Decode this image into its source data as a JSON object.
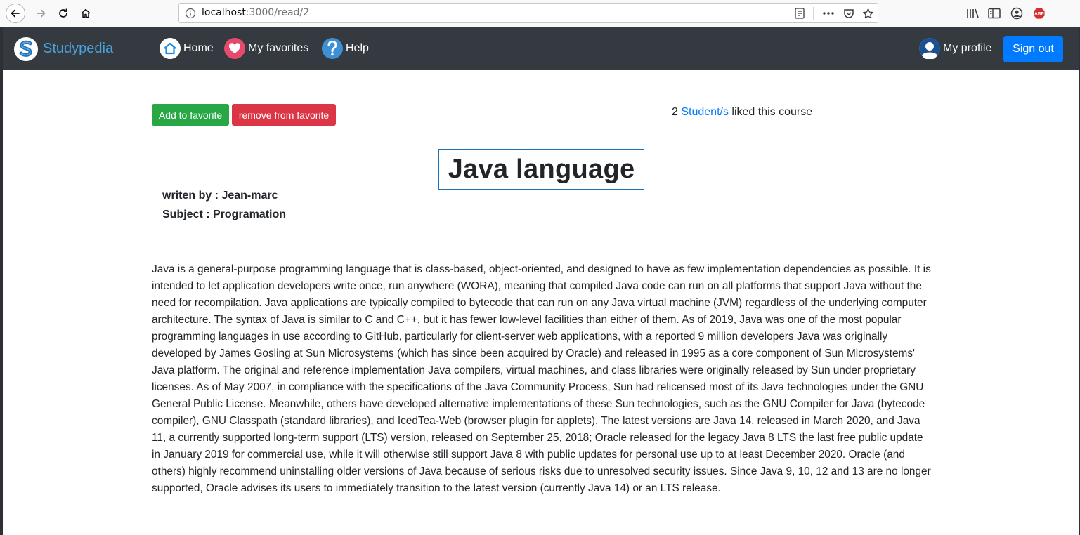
{
  "browser": {
    "url_host": "localhost",
    "url_path": ":3000/read/2"
  },
  "navbar": {
    "brand": "Studypedia",
    "home": "Home",
    "favorites": "My favorites",
    "help": "Help",
    "profile": "My profile",
    "signout": "Sign out"
  },
  "actions": {
    "add": "Add to favorite",
    "remove": "remove from favorite"
  },
  "likes": {
    "count": "2",
    "link": "Student/s",
    "suffix": "liked this course"
  },
  "course": {
    "title": "Java language",
    "author": "writen by : Jean-marc",
    "subject": "Subject : Programation",
    "body": "Java is a general-purpose programming language that is class-based, object-oriented, and designed to have as few implementation dependencies as possible. It is intended to let application developers write once, run anywhere (WORA), meaning that compiled Java code can run on all platforms that support Java without the need for recompilation. Java applications are typically compiled to bytecode that can run on any Java virtual machine (JVM) regardless of the underlying computer architecture. The syntax of Java is similar to C and C++, but it has fewer low-level facilities than either of them. As of 2019, Java was one of the most popular programming languages in use according to GitHub, particularly for client-server web applications, with a reported 9 million developers Java was originally developed by James Gosling at Sun Microsystems (which has since been acquired by Oracle) and released in 1995 as a core component of Sun Microsystems' Java platform. The original and reference implementation Java compilers, virtual machines, and class libraries were originally released by Sun under proprietary licenses. As of May 2007, in compliance with the specifications of the Java Community Process, Sun had relicensed most of its Java technologies under the GNU General Public License. Meanwhile, others have developed alternative implementations of these Sun technologies, such as the GNU Compiler for Java (bytecode compiler), GNU Classpath (standard libraries), and IcedTea-Web (browser plugin for applets). The latest versions are Java 14, released in March 2020, and Java 11, a currently supported long-term support (LTS) version, released on September 25, 2018; Oracle released for the legacy Java 8 LTS the last free public update in January 2019 for commercial use, while it will otherwise still support Java 8 with public updates for personal use up to at least December 2020. Oracle (and others) highly recommend uninstalling older versions of Java because of serious risks due to unresolved security issues. Since Java 9, 10, 12 and 13 are no longer supported, Oracle advises its users to immediately transition to the latest version (currently Java 14) or an LTS release."
  },
  "colors": {
    "navbar": "#343a40",
    "brand": "#4aa3df",
    "primary": "#007bff",
    "success": "#28a745",
    "danger": "#dc3545"
  }
}
